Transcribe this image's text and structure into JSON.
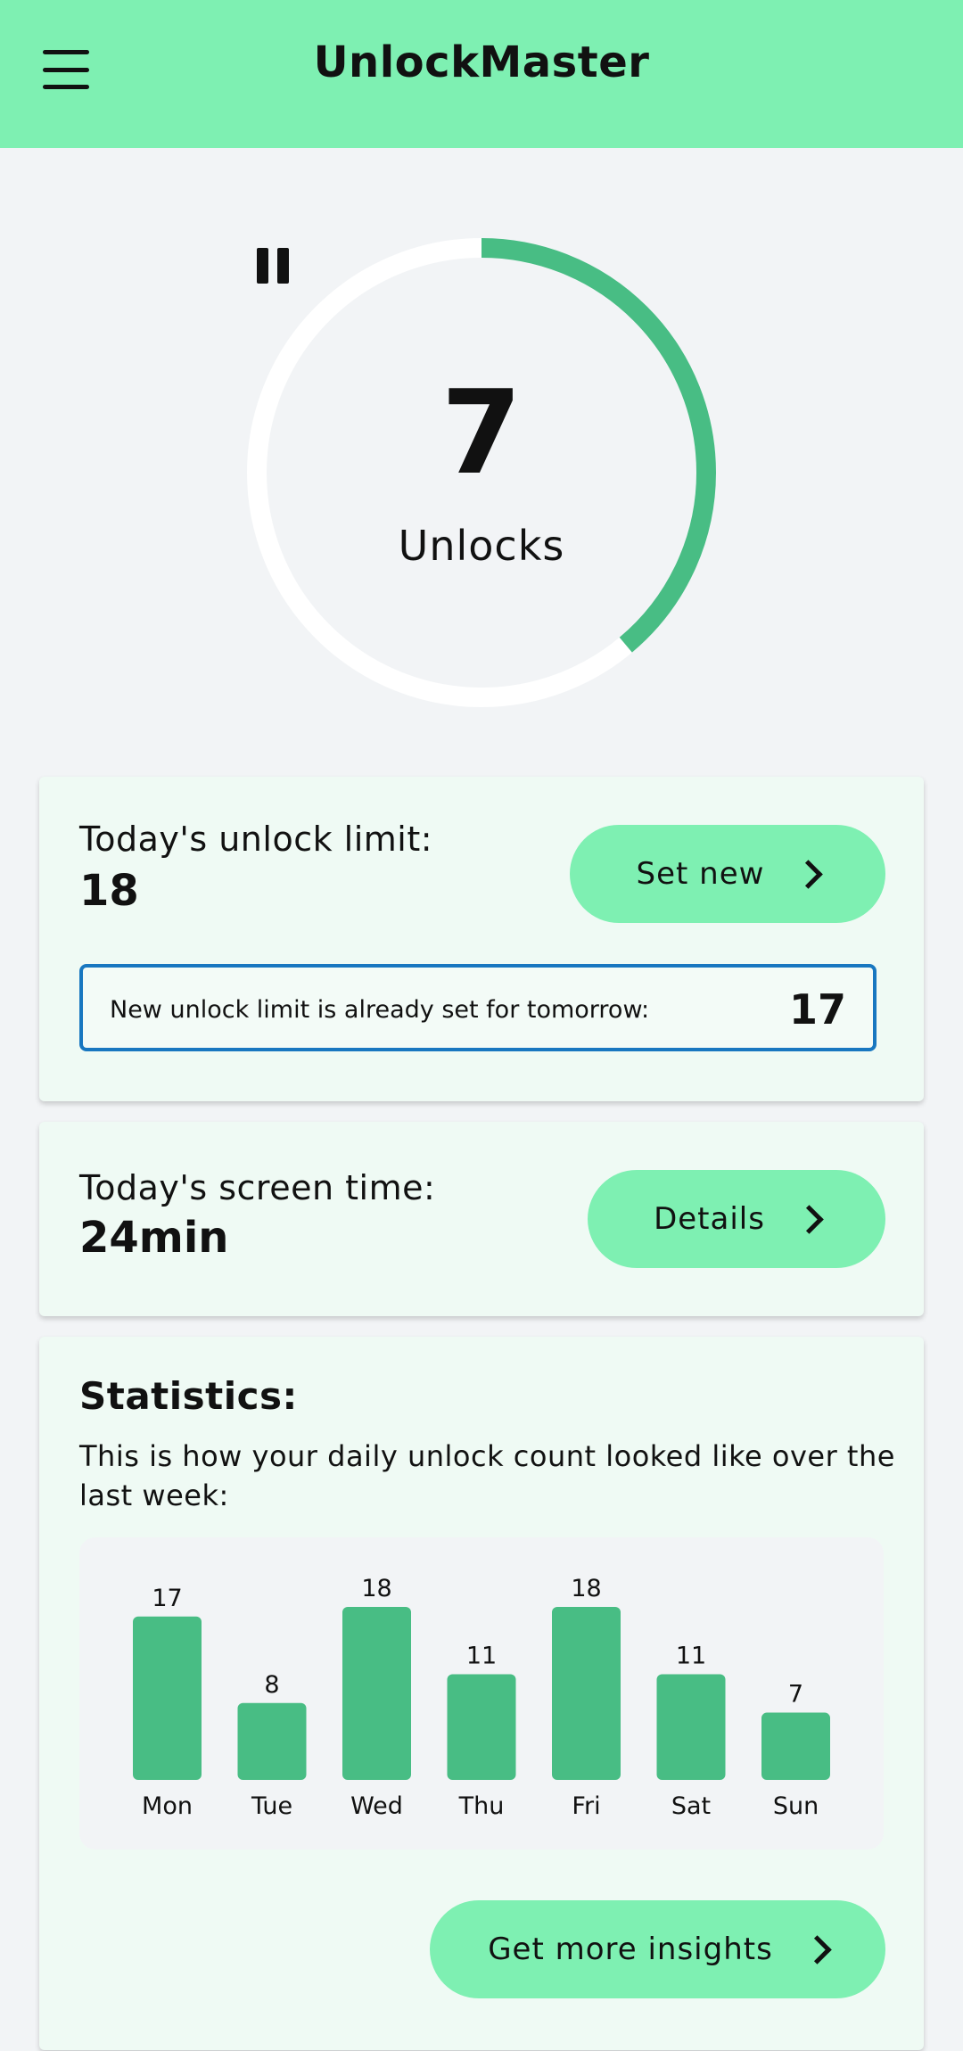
{
  "app": {
    "title": "UnlockMaster"
  },
  "progress": {
    "count": "7",
    "label": "Unlocks",
    "fraction": 0.389
  },
  "limit": {
    "label": "Today's unlock limit:",
    "value": "18",
    "button": "Set new",
    "tomorrow_text": "New unlock limit is already set for tomorrow:",
    "tomorrow_value": "17"
  },
  "screen_time": {
    "label": "Today's screen time:",
    "value": "24min",
    "button": "Details"
  },
  "statistics": {
    "title": "Statistics:",
    "description": "This is how your daily unlock count looked like over the last week:",
    "button": "Get more insights"
  },
  "colors": {
    "accent": "#7ef0b2",
    "bar": "#48bd84",
    "notice_border": "#1877c0"
  },
  "chart_data": {
    "type": "bar",
    "categories": [
      "Mon",
      "Tue",
      "Wed",
      "Thu",
      "Fri",
      "Sat",
      "Sun"
    ],
    "values": [
      17,
      8,
      18,
      11,
      18,
      11,
      7
    ],
    "title": "",
    "xlabel": "",
    "ylabel": "",
    "ylim": [
      0,
      18
    ]
  }
}
